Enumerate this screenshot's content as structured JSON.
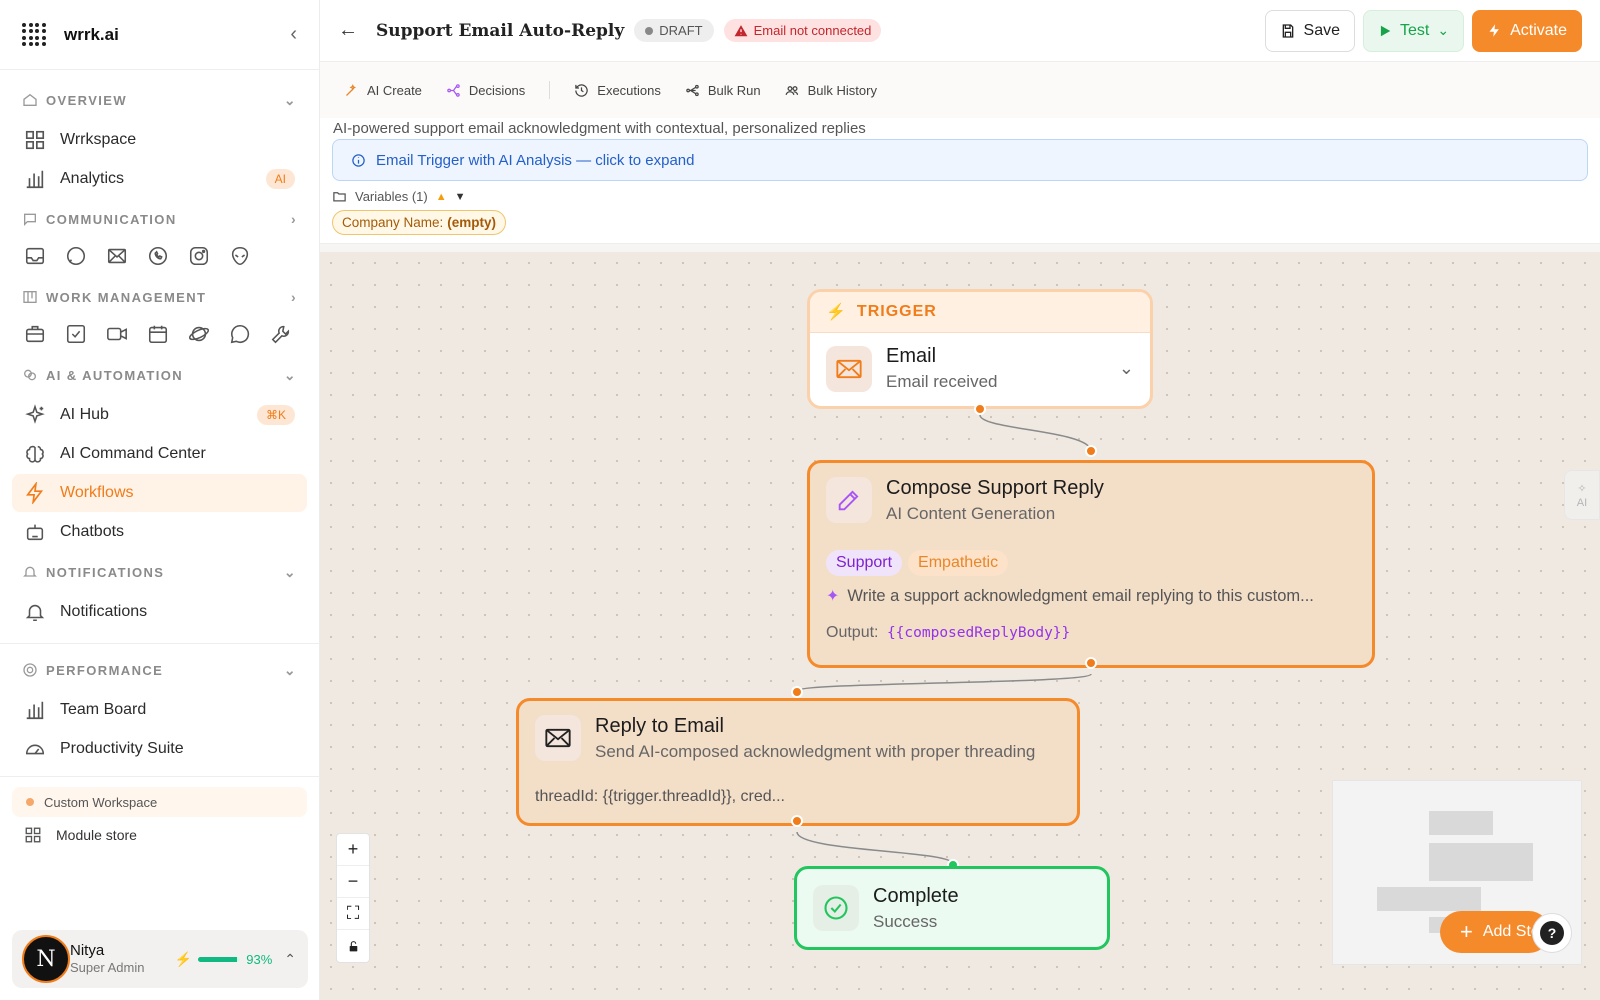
{
  "app": {
    "name": "wrrk.ai"
  },
  "sidebar": {
    "overview": {
      "label": "OVERVIEW",
      "items": [
        {
          "label": "Wrrkspace"
        },
        {
          "label": "Analytics",
          "badge": "AI"
        }
      ]
    },
    "communication": {
      "label": "COMMUNICATION",
      "icons": [
        "inbox-icon",
        "chat-bubble-icon",
        "mail-icon",
        "whatsapp-icon",
        "instagram-icon",
        "alien-icon"
      ]
    },
    "work": {
      "label": "WORK MANAGEMENT",
      "icons": [
        "briefcase-icon",
        "checkbox-icon",
        "video-icon",
        "calendar-icon",
        "planet-icon",
        "comment-icon",
        "wrench-icon"
      ]
    },
    "ai": {
      "label": "AI & AUTOMATION",
      "items": [
        {
          "label": "AI Hub",
          "badge": "⌘K"
        },
        {
          "label": "AI Command Center"
        },
        {
          "label": "Workflows"
        },
        {
          "label": "Chatbots"
        }
      ]
    },
    "notifications": {
      "label": "NOTIFICATIONS",
      "items": [
        {
          "label": "Notifications"
        }
      ]
    },
    "performance": {
      "label": "PERFORMANCE",
      "items": [
        {
          "label": "Team Board"
        },
        {
          "label": "Productivity Suite"
        }
      ]
    },
    "workspace": {
      "label": "Custom Workspace"
    },
    "module_store": {
      "label": "Module store"
    },
    "user": {
      "initial": "N",
      "name": "Nitya",
      "role": "Super Admin",
      "energy_percent": 93,
      "energy_label": "93%"
    }
  },
  "header": {
    "title": "Support Email Auto-Reply",
    "status": "DRAFT",
    "warning": "Email not connected",
    "save_label": "Save",
    "test_label": "Test",
    "activate_label": "Activate"
  },
  "toolbar": {
    "items": [
      {
        "label": "AI Create"
      },
      {
        "label": "Decisions"
      },
      {
        "label": "Executions"
      },
      {
        "label": "Bulk Run"
      },
      {
        "label": "Bulk History"
      }
    ]
  },
  "workflow": {
    "description": "AI-powered support email acknowledgment with contextual, personalized replies",
    "expand_label": "Email Trigger with AI Analysis — click to expand",
    "variables_label": "Variables (1)",
    "variable": {
      "name": "Company Name:",
      "value": "(empty)"
    }
  },
  "nodes": {
    "trigger": {
      "header": "TRIGGER",
      "title": "Email",
      "subtitle": "Email received"
    },
    "compose": {
      "title": "Compose Support Reply",
      "subtitle": "AI Content Generation",
      "tags": [
        "Support",
        "Empathetic"
      ],
      "prompt": "Write a support acknowledgment email replying to this custom...",
      "output_label": "Output:",
      "output_value": "{{composedReplyBody}}"
    },
    "reply": {
      "title": "Reply to Email",
      "subtitle": "Send AI-composed acknowledgment with proper threading",
      "params": "threadId: {{trigger.threadId}}, cred..."
    },
    "complete": {
      "title": "Complete",
      "subtitle": "Success"
    }
  },
  "canvas": {
    "add_step_label": "Add Step",
    "ai_tab_label": "AI",
    "help_label": "?"
  },
  "colors": {
    "accent": "#f58a2b",
    "success": "#22c55e",
    "purple": "#9333ea",
    "info": "#2460c8"
  }
}
